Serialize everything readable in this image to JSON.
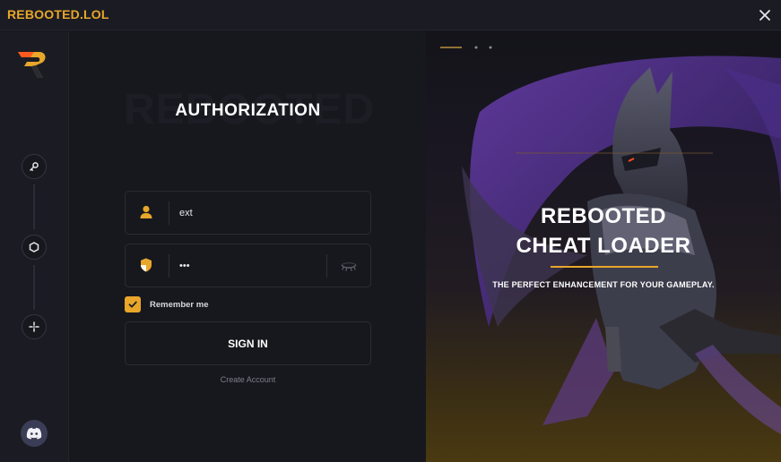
{
  "app": {
    "title": "REBOOTED.LOL"
  },
  "login": {
    "watermark": "REBOOTED",
    "heading": "AUTHORIZATION",
    "username_value": "ext",
    "password_value": "•••",
    "remember_label": "Remember me",
    "remember_checked": true,
    "signin_label": "SIGN IN",
    "create_account_label": "Create Account"
  },
  "hero": {
    "title_line1": "REBOOTED",
    "title_line2": "CHEAT LOADER",
    "tagline": "THE PERFECT ENHANCEMENT FOR YOUR GAMEPLAY."
  },
  "icons": [
    "close-icon",
    "rebooted-logo-icon",
    "key-icon",
    "hexagon-icon",
    "crosshair-icon",
    "discord-icon",
    "user-icon",
    "shield-icon",
    "eye-slash-icon",
    "checkmark-icon"
  ],
  "colors": {
    "accent": "#e8a62a",
    "background": "#17181e",
    "sidebar": "#1b1c23"
  }
}
